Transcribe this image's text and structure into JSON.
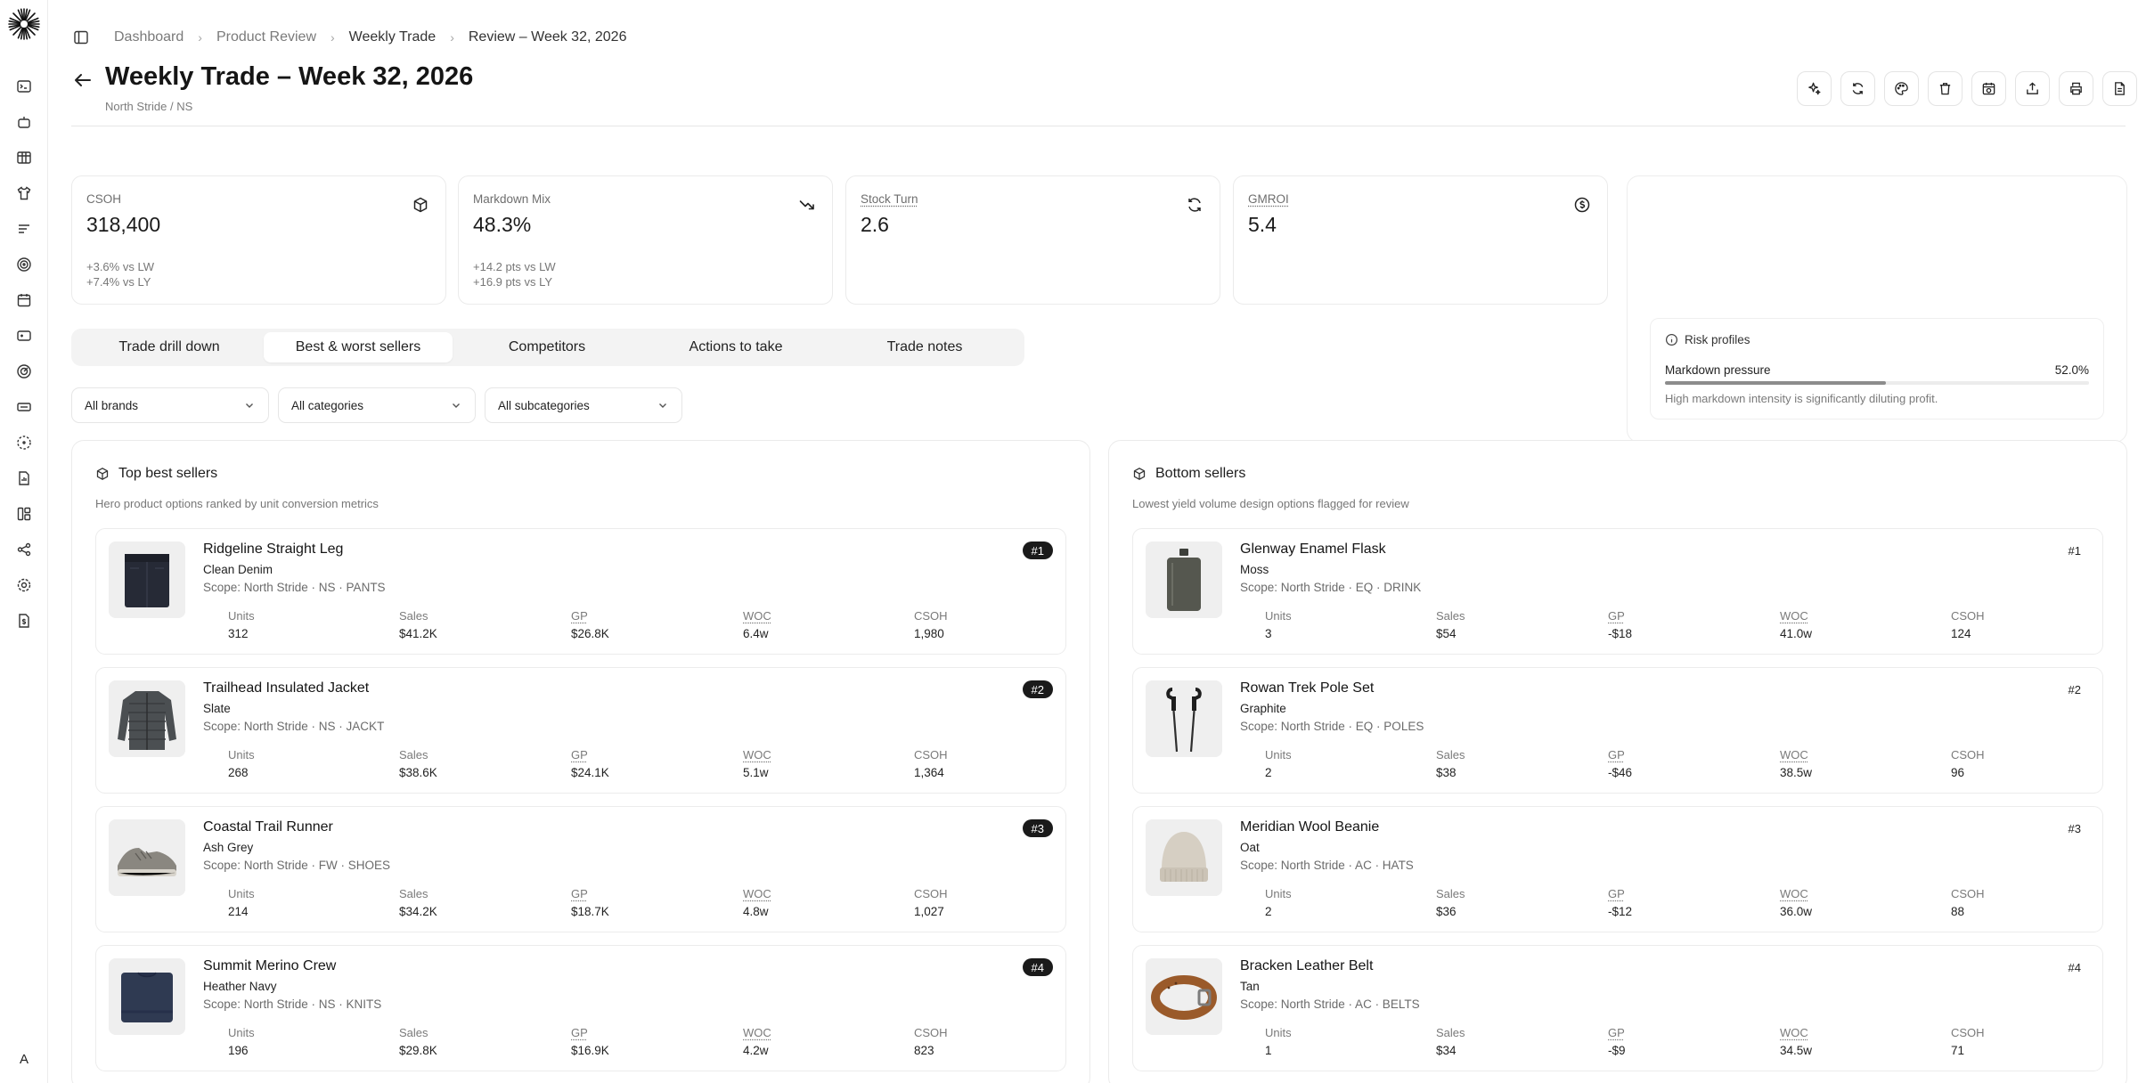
{
  "breadcrumb": {
    "items": [
      "Dashboard",
      "Product Review",
      "Weekly Trade",
      "Review – Week 32, 2026"
    ]
  },
  "page": {
    "title": "Weekly Trade – Week 32, 2026",
    "subtitle": "North Stride / NS"
  },
  "kpis": [
    {
      "label": "CSOH",
      "value": "318,400",
      "delta1": "+3.6% vs LW",
      "delta2": "+7.4% vs LY",
      "icon": "package-icon"
    },
    {
      "label": "Markdown Mix",
      "value": "48.3%",
      "delta1": "+14.2 pts vs LW",
      "delta2": "+16.9 pts vs LY",
      "icon": "trending-down-icon"
    },
    {
      "label": "Stock Turn",
      "value": "2.6",
      "delta1": "",
      "delta2": "",
      "icon": "refresh-icon"
    },
    {
      "label": "GMROI",
      "value": "5.4",
      "delta1": "",
      "delta2": "",
      "icon": "dollar-icon"
    }
  ],
  "risk": {
    "title": "Risk profiles",
    "label": "Markdown pressure",
    "percent": "52.0%",
    "fill": 0.52,
    "description": "High markdown intensity is significantly diluting profit."
  },
  "tabs": [
    "Trade drill down",
    "Best & worst sellers",
    "Competitors",
    "Actions to take",
    "Trade notes"
  ],
  "active_tab": 1,
  "filters": [
    "All brands",
    "All categories",
    "All subcategories"
  ],
  "metric_labels": [
    "Units",
    "Sales",
    "GP",
    "WOC",
    "CSOH"
  ],
  "best": {
    "title": "Top best sellers",
    "description": "Hero product options ranked by unit conversion metrics",
    "items": [
      {
        "name": "Ridgeline Straight Leg",
        "color": "Clean Denim",
        "scope": "Scope: North Stride · NS · PANTS",
        "rank": "#1",
        "units": "312",
        "sales": "$41.2K",
        "gp": "$26.8K",
        "woc": "6.4w",
        "csoh": "1,980",
        "image": "jeans"
      },
      {
        "name": "Trailhead Insulated Jacket",
        "color": "Slate",
        "scope": "Scope: North Stride · NS · JACKT",
        "rank": "#2",
        "units": "268",
        "sales": "$38.6K",
        "gp": "$24.1K",
        "woc": "5.1w",
        "csoh": "1,364",
        "image": "jacket"
      },
      {
        "name": "Coastal Trail Runner",
        "color": "Ash Grey",
        "scope": "Scope: North Stride · FW · SHOES",
        "rank": "#3",
        "units": "214",
        "sales": "$34.2K",
        "gp": "$18.7K",
        "woc": "4.8w",
        "csoh": "1,027",
        "image": "shoe"
      },
      {
        "name": "Summit Merino Crew",
        "color": "Heather Navy",
        "scope": "Scope: North Stride · NS · KNITS",
        "rank": "#4",
        "units": "196",
        "sales": "$29.8K",
        "gp": "$16.9K",
        "woc": "4.2w",
        "csoh": "823",
        "image": "sweater"
      }
    ]
  },
  "worst": {
    "title": "Bottom sellers",
    "description": "Lowest yield volume design options flagged for review",
    "items": [
      {
        "name": "Glenway Enamel Flask",
        "color": "Moss",
        "scope": "Scope: North Stride · EQ · DRINK",
        "rank": "#1",
        "units": "3",
        "sales": "$54",
        "gp": "-$18",
        "woc": "41.0w",
        "csoh": "124",
        "image": "flask"
      },
      {
        "name": "Rowan Trek Pole Set",
        "color": "Graphite",
        "scope": "Scope: North Stride · EQ · POLES",
        "rank": "#2",
        "units": "2",
        "sales": "$38",
        "gp": "-$46",
        "woc": "38.5w",
        "csoh": "96",
        "image": "poles"
      },
      {
        "name": "Meridian Wool Beanie",
        "color": "Oat",
        "scope": "Scope: North Stride · AC · HATS",
        "rank": "#3",
        "units": "2",
        "sales": "$36",
        "gp": "-$12",
        "woc": "36.0w",
        "csoh": "88",
        "image": "beanie"
      },
      {
        "name": "Bracken Leather Belt",
        "color": "Tan",
        "scope": "Scope: North Stride · AC · BELTS",
        "rank": "#4",
        "units": "1",
        "sales": "$34",
        "gp": "-$9",
        "woc": "34.5w",
        "csoh": "71",
        "image": "belt"
      }
    ]
  },
  "user": {
    "initial": "A"
  },
  "colors": {
    "accent": "#1a1a1a",
    "muted": "#777777",
    "border": "#ebebeb",
    "tab_bg": "#f3f3f3"
  }
}
